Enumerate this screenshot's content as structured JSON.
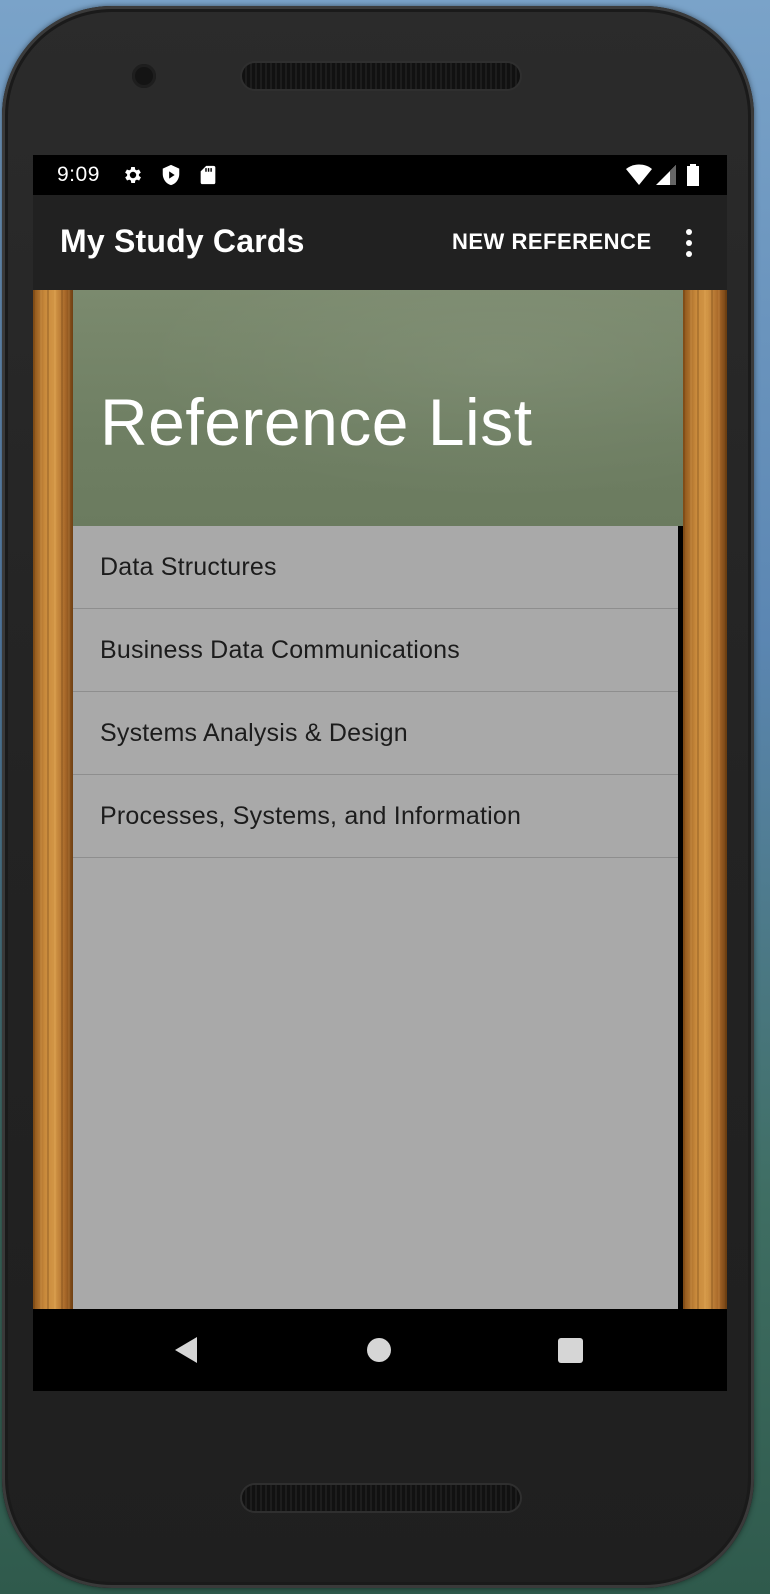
{
  "status_bar": {
    "time": "9:09",
    "left_icons": [
      "settings-icon",
      "shield-play-icon",
      "sd-card-icon"
    ],
    "right_icons": [
      "wifi-icon",
      "cell-signal-icon",
      "battery-icon"
    ]
  },
  "app_bar": {
    "title": "My Study Cards",
    "action_label": "NEW REFERENCE",
    "overflow_icon": "more-vert-icon"
  },
  "header": {
    "title": "Reference List"
  },
  "references": [
    {
      "label": "Data Structures"
    },
    {
      "label": "Business Data Communications"
    },
    {
      "label": "Systems Analysis & Design"
    },
    {
      "label": "Processes, Systems, and Information"
    }
  ],
  "nav_bar": {
    "icons": [
      "back-icon",
      "home-icon",
      "recents-icon"
    ]
  },
  "colors": {
    "app_bar": "#212121",
    "chalkboard": "#72826a",
    "list_background": "#a9a9a9",
    "wood": "#c98a3c"
  }
}
